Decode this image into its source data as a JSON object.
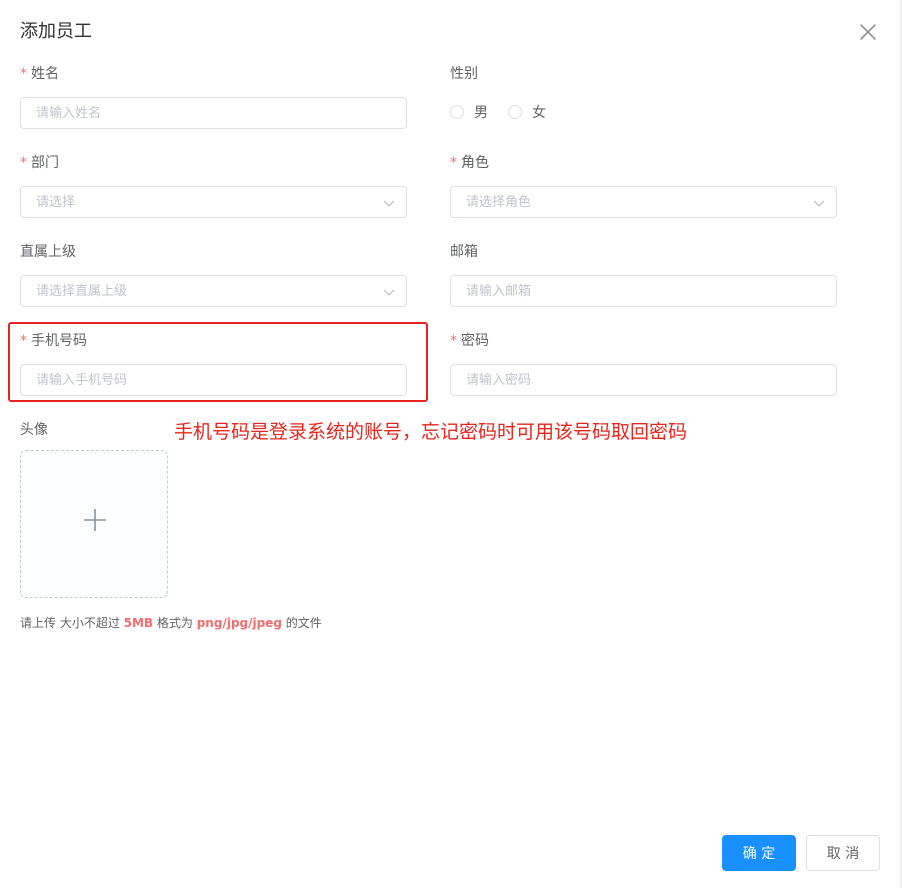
{
  "dialog": {
    "title": "添加员工"
  },
  "form": {
    "required_mark": "*",
    "name": {
      "label": "姓名",
      "placeholder": "请输入姓名"
    },
    "gender": {
      "label": "性别",
      "options": [
        "男",
        "女"
      ]
    },
    "department": {
      "label": "部门",
      "placeholder": "请选择"
    },
    "role": {
      "label": "角色",
      "placeholder": "请选择角色"
    },
    "supervisor": {
      "label": "直属上级",
      "placeholder": "请选择直属上级"
    },
    "email": {
      "label": "邮箱",
      "placeholder": "请输入邮箱"
    },
    "phone": {
      "label": "手机号码",
      "placeholder": "请输入手机号码"
    },
    "password": {
      "label": "密码",
      "placeholder": "请输入密码"
    },
    "avatar": {
      "label": "头像"
    }
  },
  "annotation": "手机号码是登录系统的账号，忘记密码时可用该号码取回密码",
  "upload_tip": {
    "prefix": "请上传 大小不超过 ",
    "size": "5MB",
    "middle": " 格式为 ",
    "formats": "png/jpg/jpeg",
    "suffix": " 的文件"
  },
  "footer": {
    "confirm_label": "确 定",
    "cancel_label": "取 消"
  },
  "colors": {
    "primary": "#1890ff",
    "required": "#f56c6c",
    "annotation": "#e6251c"
  },
  "icons": {
    "close": "close-icon",
    "select_arrow": "chevron-down-icon",
    "upload": "plus-icon"
  }
}
